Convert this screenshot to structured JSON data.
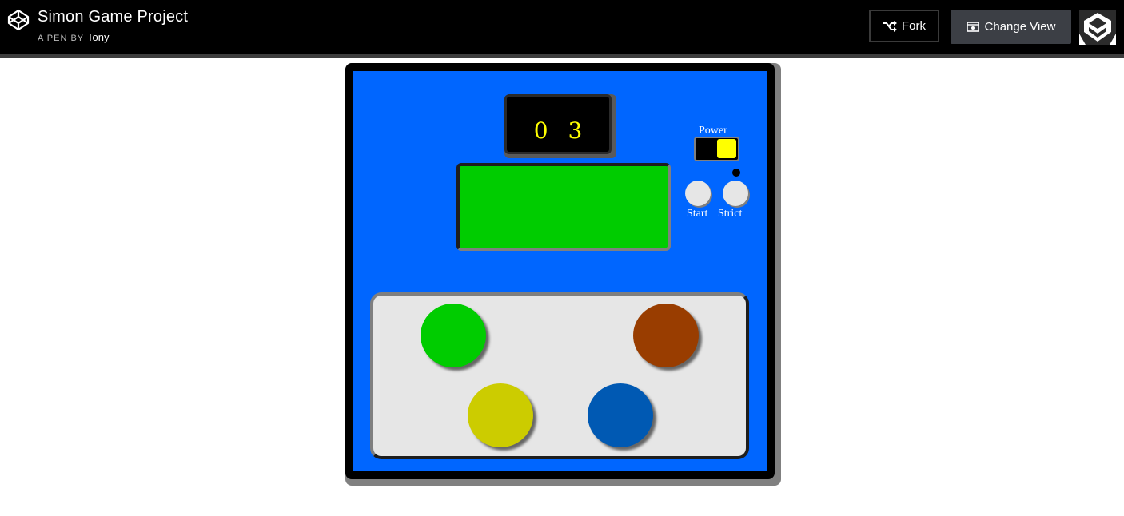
{
  "header": {
    "title": "Simon Game Project",
    "byline_prefix": "A PEN BY",
    "author": "Tony",
    "fork_label": "Fork",
    "change_view_label": "Change View"
  },
  "game": {
    "counter": "0 3",
    "power_label": "Power",
    "power_on": true,
    "start_label": "Start",
    "strict_label": "Strict",
    "colors": {
      "board": "#0066ff",
      "display": "#00cc00",
      "counter_text": "#ffff00",
      "green": "#00cc00",
      "brown": "#993d00",
      "yellow": "#cccc00",
      "blue": "#0059b3"
    },
    "buttons": [
      "green",
      "brown",
      "yellow",
      "blue"
    ]
  }
}
